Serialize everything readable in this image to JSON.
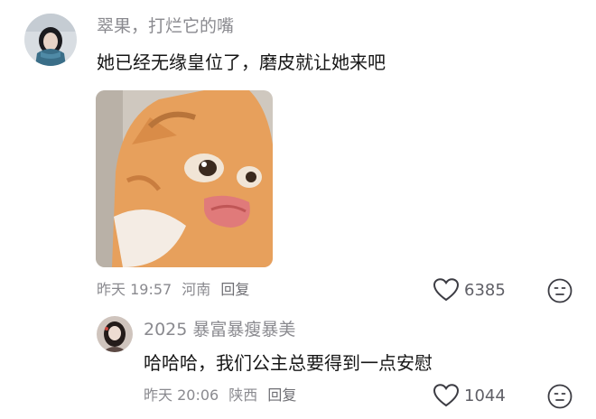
{
  "comments": [
    {
      "username": "翠果，打烂它的嘴",
      "text": "她已经无缘皇位了，磨皮就让她来吧",
      "has_sticker": true,
      "sticker_icon": "cat-pout-sticker",
      "time": "昨天 19:57",
      "location": "河南",
      "reply_label": "回复",
      "likes": "6385"
    },
    {
      "username": "2025 暴富暴瘦暴美",
      "text": "哈哈哈，我们公主总要得到一点安慰",
      "time": "昨天 20:06",
      "location": "陕西",
      "reply_label": "回复",
      "likes": "1044"
    }
  ]
}
